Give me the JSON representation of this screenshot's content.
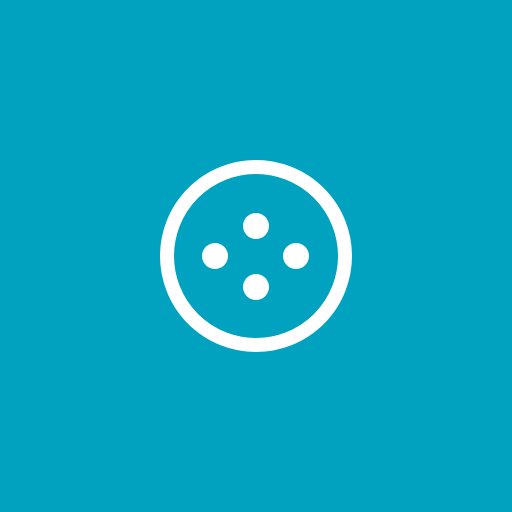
{
  "app_tile": {
    "background_color": "#00A2BF",
    "icon": {
      "name": "button-icon",
      "color": "#FFFFFF"
    }
  }
}
